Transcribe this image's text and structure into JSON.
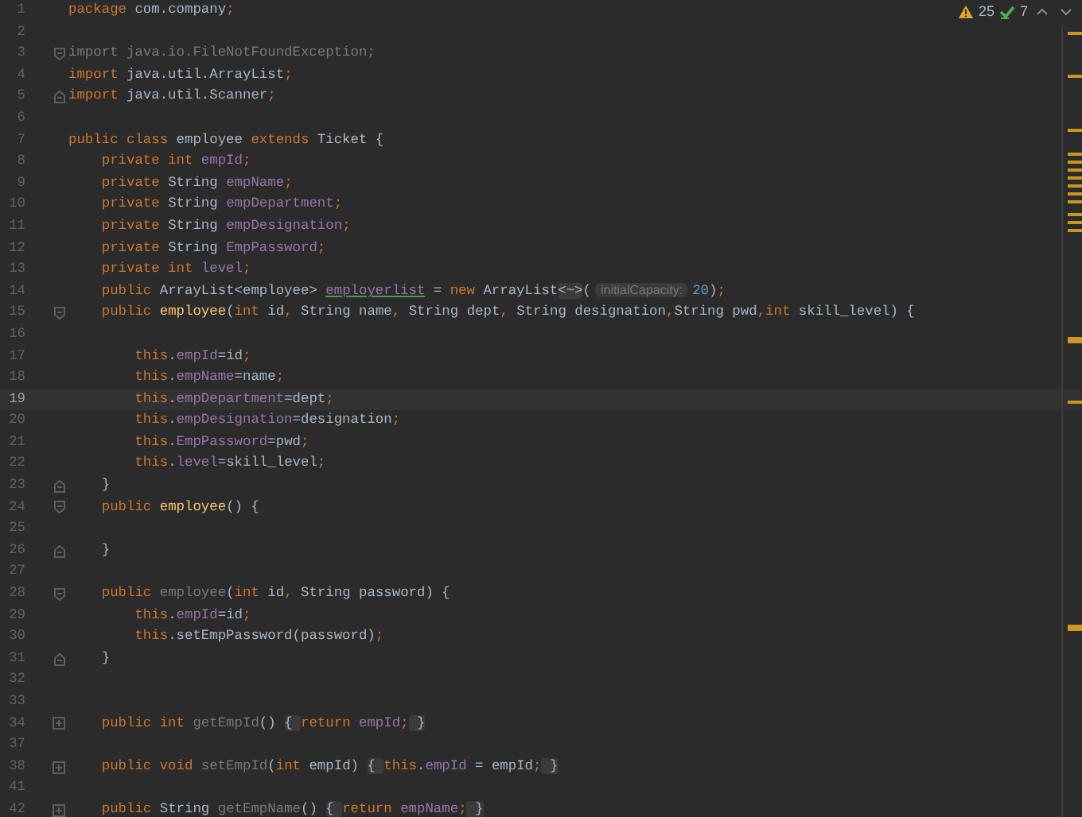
{
  "inspections": {
    "warnings": "25",
    "checks": "7"
  },
  "lines": [
    {
      "number": "1",
      "current": false,
      "kind": "plain",
      "tokens": [
        {
          "kind": "kw",
          "text": "package"
        },
        {
          "kind": "plain",
          "text": " com.company"
        },
        {
          "kind": "kw",
          "text": ";"
        }
      ]
    },
    {
      "number": "2",
      "current": false,
      "kind": "plain"
    },
    {
      "number": "3",
      "current": false,
      "kind": "opener",
      "tokens": [
        {
          "kind": "unused",
          "text": "import java.io.FileNotFoundException;"
        }
      ]
    },
    {
      "number": "4",
      "current": false,
      "kind": "plain",
      "tokens": [
        {
          "kind": "kw",
          "text": "import"
        },
        {
          "kind": "plain",
          "text": " java.util.ArrayList"
        },
        {
          "kind": "kw",
          "text": ";"
        }
      ]
    },
    {
      "number": "5",
      "current": false,
      "kind": "closer",
      "tokens": [
        {
          "kind": "kw",
          "text": "import"
        },
        {
          "kind": "plain",
          "text": " java.util.Scanner"
        },
        {
          "kind": "kw",
          "text": ";"
        }
      ]
    },
    {
      "number": "6",
      "current": false,
      "kind": "plain"
    },
    {
      "number": "7",
      "current": false,
      "kind": "plain",
      "tokens": [
        {
          "kind": "kw",
          "text": "public class "
        },
        {
          "kind": "plain",
          "text": "employee "
        },
        {
          "kind": "kw",
          "text": "extends "
        },
        {
          "kind": "plain",
          "text": "Ticket {"
        }
      ]
    },
    {
      "number": "8",
      "current": false,
      "kind": "plain",
      "tokens": [
        {
          "kind": "kw",
          "text": "    private int "
        },
        {
          "kind": "field",
          "text": "empId"
        },
        {
          "kind": "kw",
          "text": ";"
        }
      ]
    },
    {
      "number": "9",
      "current": false,
      "kind": "plain",
      "tokens": [
        {
          "kind": "kw",
          "text": "    private "
        },
        {
          "kind": "plain",
          "text": "String "
        },
        {
          "kind": "field",
          "text": "empName"
        },
        {
          "kind": "kw",
          "text": ";"
        }
      ]
    },
    {
      "number": "10",
      "current": false,
      "kind": "plain",
      "tokens": [
        {
          "kind": "kw",
          "text": "    private "
        },
        {
          "kind": "plain",
          "text": "String "
        },
        {
          "kind": "field",
          "text": "empDepartment"
        },
        {
          "kind": "kw",
          "text": ";"
        }
      ]
    },
    {
      "number": "11",
      "current": false,
      "kind": "plain",
      "tokens": [
        {
          "kind": "kw",
          "text": "    private "
        },
        {
          "kind": "plain",
          "text": "String "
        },
        {
          "kind": "field",
          "text": "empDesignation"
        },
        {
          "kind": "kw",
          "text": ";"
        }
      ]
    },
    {
      "number": "12",
      "current": false,
      "kind": "plain",
      "tokens": [
        {
          "kind": "kw",
          "text": "    private "
        },
        {
          "kind": "plain",
          "text": "String "
        },
        {
          "kind": "field",
          "text": "EmpPassword"
        },
        {
          "kind": "kw",
          "text": ";"
        }
      ]
    },
    {
      "number": "13",
      "current": false,
      "kind": "plain",
      "tokens": [
        {
          "kind": "kw",
          "text": "    private int "
        },
        {
          "kind": "field",
          "text": "level"
        },
        {
          "kind": "kw",
          "text": ";"
        }
      ]
    },
    {
      "number": "14",
      "current": false,
      "kind": "plain",
      "tokens": [
        {
          "kind": "kw",
          "text": "    public "
        },
        {
          "kind": "plain",
          "text": "ArrayList<employee> "
        },
        {
          "kind": "link",
          "text": "employerlist"
        },
        {
          "kind": "plain",
          "text": " = "
        },
        {
          "kind": "kw",
          "text": "new "
        },
        {
          "kind": "plain",
          "text": "ArrayList"
        },
        {
          "kind": "folded",
          "text": "<~>"
        },
        {
          "kind": "plain",
          "text": "("
        },
        {
          "kind": "hint",
          "text": "initialCapacity:"
        },
        {
          "kind": "num",
          "text": "20"
        },
        {
          "kind": "plain",
          "text": ")"
        },
        {
          "kind": "kw",
          "text": ";"
        }
      ]
    },
    {
      "number": "15",
      "current": false,
      "kind": "opener",
      "tokens": [
        {
          "kind": "kw",
          "text": "    public "
        },
        {
          "kind": "decl",
          "text": "employee"
        },
        {
          "kind": "plain",
          "text": "("
        },
        {
          "kind": "kw",
          "text": "int "
        },
        {
          "kind": "plain",
          "text": "id"
        },
        {
          "kind": "kw",
          "text": ", "
        },
        {
          "kind": "plain",
          "text": "String name"
        },
        {
          "kind": "kw",
          "text": ", "
        },
        {
          "kind": "plain",
          "text": "String dept"
        },
        {
          "kind": "kw",
          "text": ", "
        },
        {
          "kind": "plain",
          "text": "String designation"
        },
        {
          "kind": "kw",
          "text": ","
        },
        {
          "kind": "plain",
          "text": "String pwd"
        },
        {
          "kind": "kw",
          "text": ",int "
        },
        {
          "kind": "plain",
          "text": "skill_level) {"
        }
      ]
    },
    {
      "number": "16",
      "current": false,
      "kind": "plain"
    },
    {
      "number": "17",
      "current": false,
      "kind": "plain",
      "tokens": [
        {
          "kind": "kw",
          "text": "        this"
        },
        {
          "kind": "plain",
          "text": "."
        },
        {
          "kind": "field",
          "text": "empId"
        },
        {
          "kind": "plain",
          "text": "=id"
        },
        {
          "kind": "kw",
          "text": ";"
        }
      ]
    },
    {
      "number": "18",
      "current": false,
      "kind": "plain",
      "tokens": [
        {
          "kind": "kw",
          "text": "        this"
        },
        {
          "kind": "plain",
          "text": "."
        },
        {
          "kind": "field",
          "text": "empName"
        },
        {
          "kind": "plain",
          "text": "=name"
        },
        {
          "kind": "kw",
          "text": ";"
        }
      ]
    },
    {
      "number": "19",
      "current": true,
      "kind": "plain",
      "tokens": [
        {
          "kind": "kw",
          "text": "        this"
        },
        {
          "kind": "plain",
          "text": "."
        },
        {
          "kind": "field",
          "text": "empDepartment"
        },
        {
          "kind": "plain",
          "text": "=dept"
        },
        {
          "kind": "kw",
          "text": ";"
        }
      ]
    },
    {
      "number": "20",
      "current": false,
      "kind": "plain",
      "tokens": [
        {
          "kind": "kw",
          "text": "        this"
        },
        {
          "kind": "plain",
          "text": "."
        },
        {
          "kind": "field",
          "text": "empDesignation"
        },
        {
          "kind": "plain",
          "text": "=designation"
        },
        {
          "kind": "kw",
          "text": ";"
        }
      ]
    },
    {
      "number": "21",
      "current": false,
      "kind": "plain",
      "tokens": [
        {
          "kind": "kw",
          "text": "        this"
        },
        {
          "kind": "plain",
          "text": "."
        },
        {
          "kind": "field",
          "text": "EmpPassword"
        },
        {
          "kind": "plain",
          "text": "=pwd"
        },
        {
          "kind": "kw",
          "text": ";"
        }
      ]
    },
    {
      "number": "22",
      "current": false,
      "kind": "plain",
      "tokens": [
        {
          "kind": "kw",
          "text": "        this"
        },
        {
          "kind": "plain",
          "text": "."
        },
        {
          "kind": "field",
          "text": "level"
        },
        {
          "kind": "plain",
          "text": "=skill_level"
        },
        {
          "kind": "kw",
          "text": ";"
        }
      ]
    },
    {
      "number": "23",
      "current": false,
      "kind": "closer",
      "tokens": [
        {
          "kind": "plain",
          "text": "    }"
        }
      ]
    },
    {
      "number": "24",
      "current": false,
      "kind": "opener",
      "tokens": [
        {
          "kind": "kw",
          "text": "    public "
        },
        {
          "kind": "decl",
          "text": "employee"
        },
        {
          "kind": "plain",
          "text": "() {"
        }
      ]
    },
    {
      "number": "25",
      "current": false,
      "kind": "plain"
    },
    {
      "number": "26",
      "current": false,
      "kind": "closer",
      "tokens": [
        {
          "kind": "plain",
          "text": "    }"
        }
      ]
    },
    {
      "number": "27",
      "current": false,
      "kind": "plain"
    },
    {
      "number": "28",
      "current": false,
      "kind": "opener",
      "tokens": [
        {
          "kind": "kw",
          "text": "    public "
        },
        {
          "kind": "unused",
          "text": "employee"
        },
        {
          "kind": "plain",
          "text": "("
        },
        {
          "kind": "kw",
          "text": "int "
        },
        {
          "kind": "plain",
          "text": "id"
        },
        {
          "kind": "kw",
          "text": ", "
        },
        {
          "kind": "plain",
          "text": "String password) {"
        }
      ]
    },
    {
      "number": "29",
      "current": false,
      "kind": "plain",
      "tokens": [
        {
          "kind": "kw",
          "text": "        this"
        },
        {
          "kind": "plain",
          "text": "."
        },
        {
          "kind": "field",
          "text": "empId"
        },
        {
          "kind": "plain",
          "text": "=id"
        },
        {
          "kind": "kw",
          "text": ";"
        }
      ]
    },
    {
      "number": "30",
      "current": false,
      "kind": "plain",
      "tokens": [
        {
          "kind": "kw",
          "text": "        this"
        },
        {
          "kind": "plain",
          "text": ".setEmpPassword(password)"
        },
        {
          "kind": "kw",
          "text": ";"
        }
      ]
    },
    {
      "number": "31",
      "current": false,
      "kind": "closer",
      "tokens": [
        {
          "kind": "plain",
          "text": "    }"
        }
      ]
    },
    {
      "number": "32",
      "current": false,
      "kind": "plain"
    },
    {
      "number": "33",
      "current": false,
      "kind": "plain"
    },
    {
      "number": "34",
      "current": false,
      "kind": "collapsed",
      "tokens": [
        {
          "kind": "kw",
          "text": "    public int "
        },
        {
          "kind": "unused",
          "text": "getEmpId"
        },
        {
          "kind": "plain",
          "text": "() "
        },
        {
          "kind": "folded",
          "text": "{ "
        },
        {
          "kind": "kw",
          "text": "return "
        },
        {
          "kind": "field",
          "text": "empId"
        },
        {
          "kind": "kw",
          "text": ";"
        },
        {
          "kind": "folded",
          "text": " }"
        }
      ]
    },
    {
      "number": "37",
      "current": false,
      "kind": "plain"
    },
    {
      "number": "38",
      "current": false,
      "kind": "collapsed",
      "tokens": [
        {
          "kind": "kw",
          "text": "    public void "
        },
        {
          "kind": "unused",
          "text": "setEmpId"
        },
        {
          "kind": "plain",
          "text": "("
        },
        {
          "kind": "kw",
          "text": "int "
        },
        {
          "kind": "plain",
          "text": "empId) "
        },
        {
          "kind": "folded",
          "text": "{ "
        },
        {
          "kind": "kw",
          "text": "this"
        },
        {
          "kind": "plain",
          "text": "."
        },
        {
          "kind": "field",
          "text": "empId"
        },
        {
          "kind": "plain",
          "text": " = empId"
        },
        {
          "kind": "kw",
          "text": ";"
        },
        {
          "kind": "folded",
          "text": " }"
        }
      ]
    },
    {
      "number": "41",
      "current": false,
      "kind": "plain"
    },
    {
      "number": "42",
      "current": false,
      "kind": "collapsed",
      "tokens": [
        {
          "kind": "kw",
          "text": "    public "
        },
        {
          "kind": "plain",
          "text": "String "
        },
        {
          "kind": "unused",
          "text": "getEmpName"
        },
        {
          "kind": "plain",
          "text": "() "
        },
        {
          "kind": "folded",
          "text": "{ "
        },
        {
          "kind": "kw",
          "text": "return "
        },
        {
          "kind": "field",
          "text": "empName"
        },
        {
          "kind": "kw",
          "text": ";"
        },
        {
          "kind": "folded",
          "text": " }"
        }
      ]
    }
  ]
}
